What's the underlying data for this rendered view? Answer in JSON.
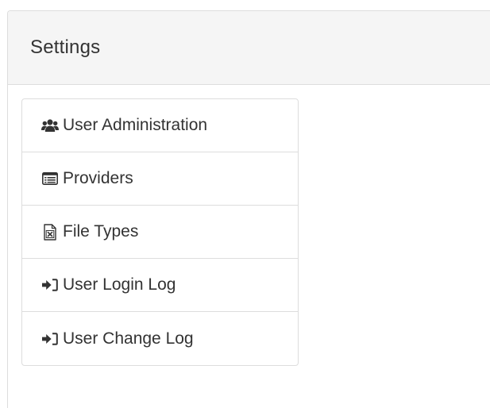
{
  "panel": {
    "title": "Settings"
  },
  "menu": {
    "items": [
      {
        "label": "User Administration",
        "icon": "users-icon"
      },
      {
        "label": "Providers",
        "icon": "list-alt-icon"
      },
      {
        "label": "File Types",
        "icon": "excel-file-icon"
      },
      {
        "label": "User Login Log",
        "icon": "sign-in-icon"
      },
      {
        "label": "User Change Log",
        "icon": "sign-in-icon"
      }
    ]
  },
  "colors": {
    "heading_background": "#f5f5f5",
    "border": "#dddddd",
    "text": "#333333"
  }
}
